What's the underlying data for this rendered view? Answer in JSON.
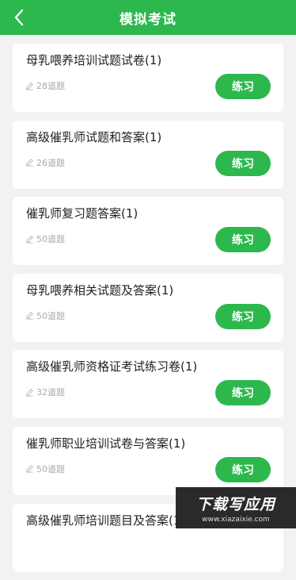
{
  "header": {
    "title": "模拟考试",
    "back_icon": "chevron-left-icon"
  },
  "exams": [
    {
      "title": "母乳喂养培训试题试卷(1)",
      "count": "28道题",
      "button": "练习"
    },
    {
      "title": "高级催乳师试题和答案(1)",
      "count": "26道题",
      "button": "练习"
    },
    {
      "title": "催乳师复习题答案(1)",
      "count": "50道题",
      "button": "练习"
    },
    {
      "title": "母乳喂养相关试题及答案(1)",
      "count": "50道题",
      "button": "练习"
    },
    {
      "title": "高级催乳师资格证考试练习卷(1)",
      "count": "32道题",
      "button": "练习"
    },
    {
      "title": "催乳师职业培训试卷与答案(1)",
      "count": "50道题",
      "button": "练习"
    },
    {
      "title": "高级催乳师培训题目及答案(1)",
      "count": "",
      "button": ""
    }
  ],
  "watermark": {
    "main": "下载写应用",
    "sub": "www.xiazaixie.com"
  },
  "colors": {
    "accent": "#2db84d",
    "background": "#f2f2f2"
  }
}
